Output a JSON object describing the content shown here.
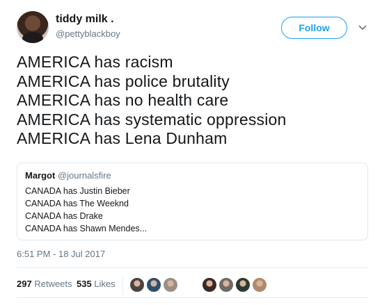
{
  "author": {
    "name": "tiddy milk .",
    "handle": "@pettyblackboy"
  },
  "follow_label": "Follow",
  "tweet_lines": [
    "AMERICA has racism",
    "AMERICA has police brutality",
    "AMERICA has no health care",
    "AMERICA has systematic oppression",
    "AMERICA has Lena Dunham"
  ],
  "quoted": {
    "name": "Margot",
    "handle": "@journalsfire",
    "lines": [
      "CANADA has Justin Bieber",
      "CANADA has The Weeknd",
      "CANADA has Drake",
      "CANADA has Shawn Mendes..."
    ]
  },
  "timestamp": "6:51 PM - 18 Jul 2017",
  "stats": {
    "retweets_count": "297",
    "retweets_label": "Retweets",
    "likes_count": "535",
    "likes_label": "Likes"
  },
  "colors": {
    "accent": "#1da1f2",
    "secondary_text": "#657786",
    "border": "#e1e8ed"
  },
  "icons": {
    "menu": "chevron-down-icon"
  },
  "likers": [
    {
      "name": "liker-avatar-1",
      "color": "#4a4440"
    },
    {
      "name": "liker-avatar-2",
      "color": "#2e4f6e"
    },
    {
      "name": "liker-avatar-3",
      "color": "#9a8f86"
    },
    {
      "name": "liker-avatar-4",
      "color": "#3a2a26"
    },
    {
      "name": "liker-avatar-5",
      "color": "#6e6a66"
    },
    {
      "name": "liker-avatar-6",
      "color": "#2a3a33"
    },
    {
      "name": "liker-avatar-7",
      "color": "#b08a6e"
    }
  ]
}
